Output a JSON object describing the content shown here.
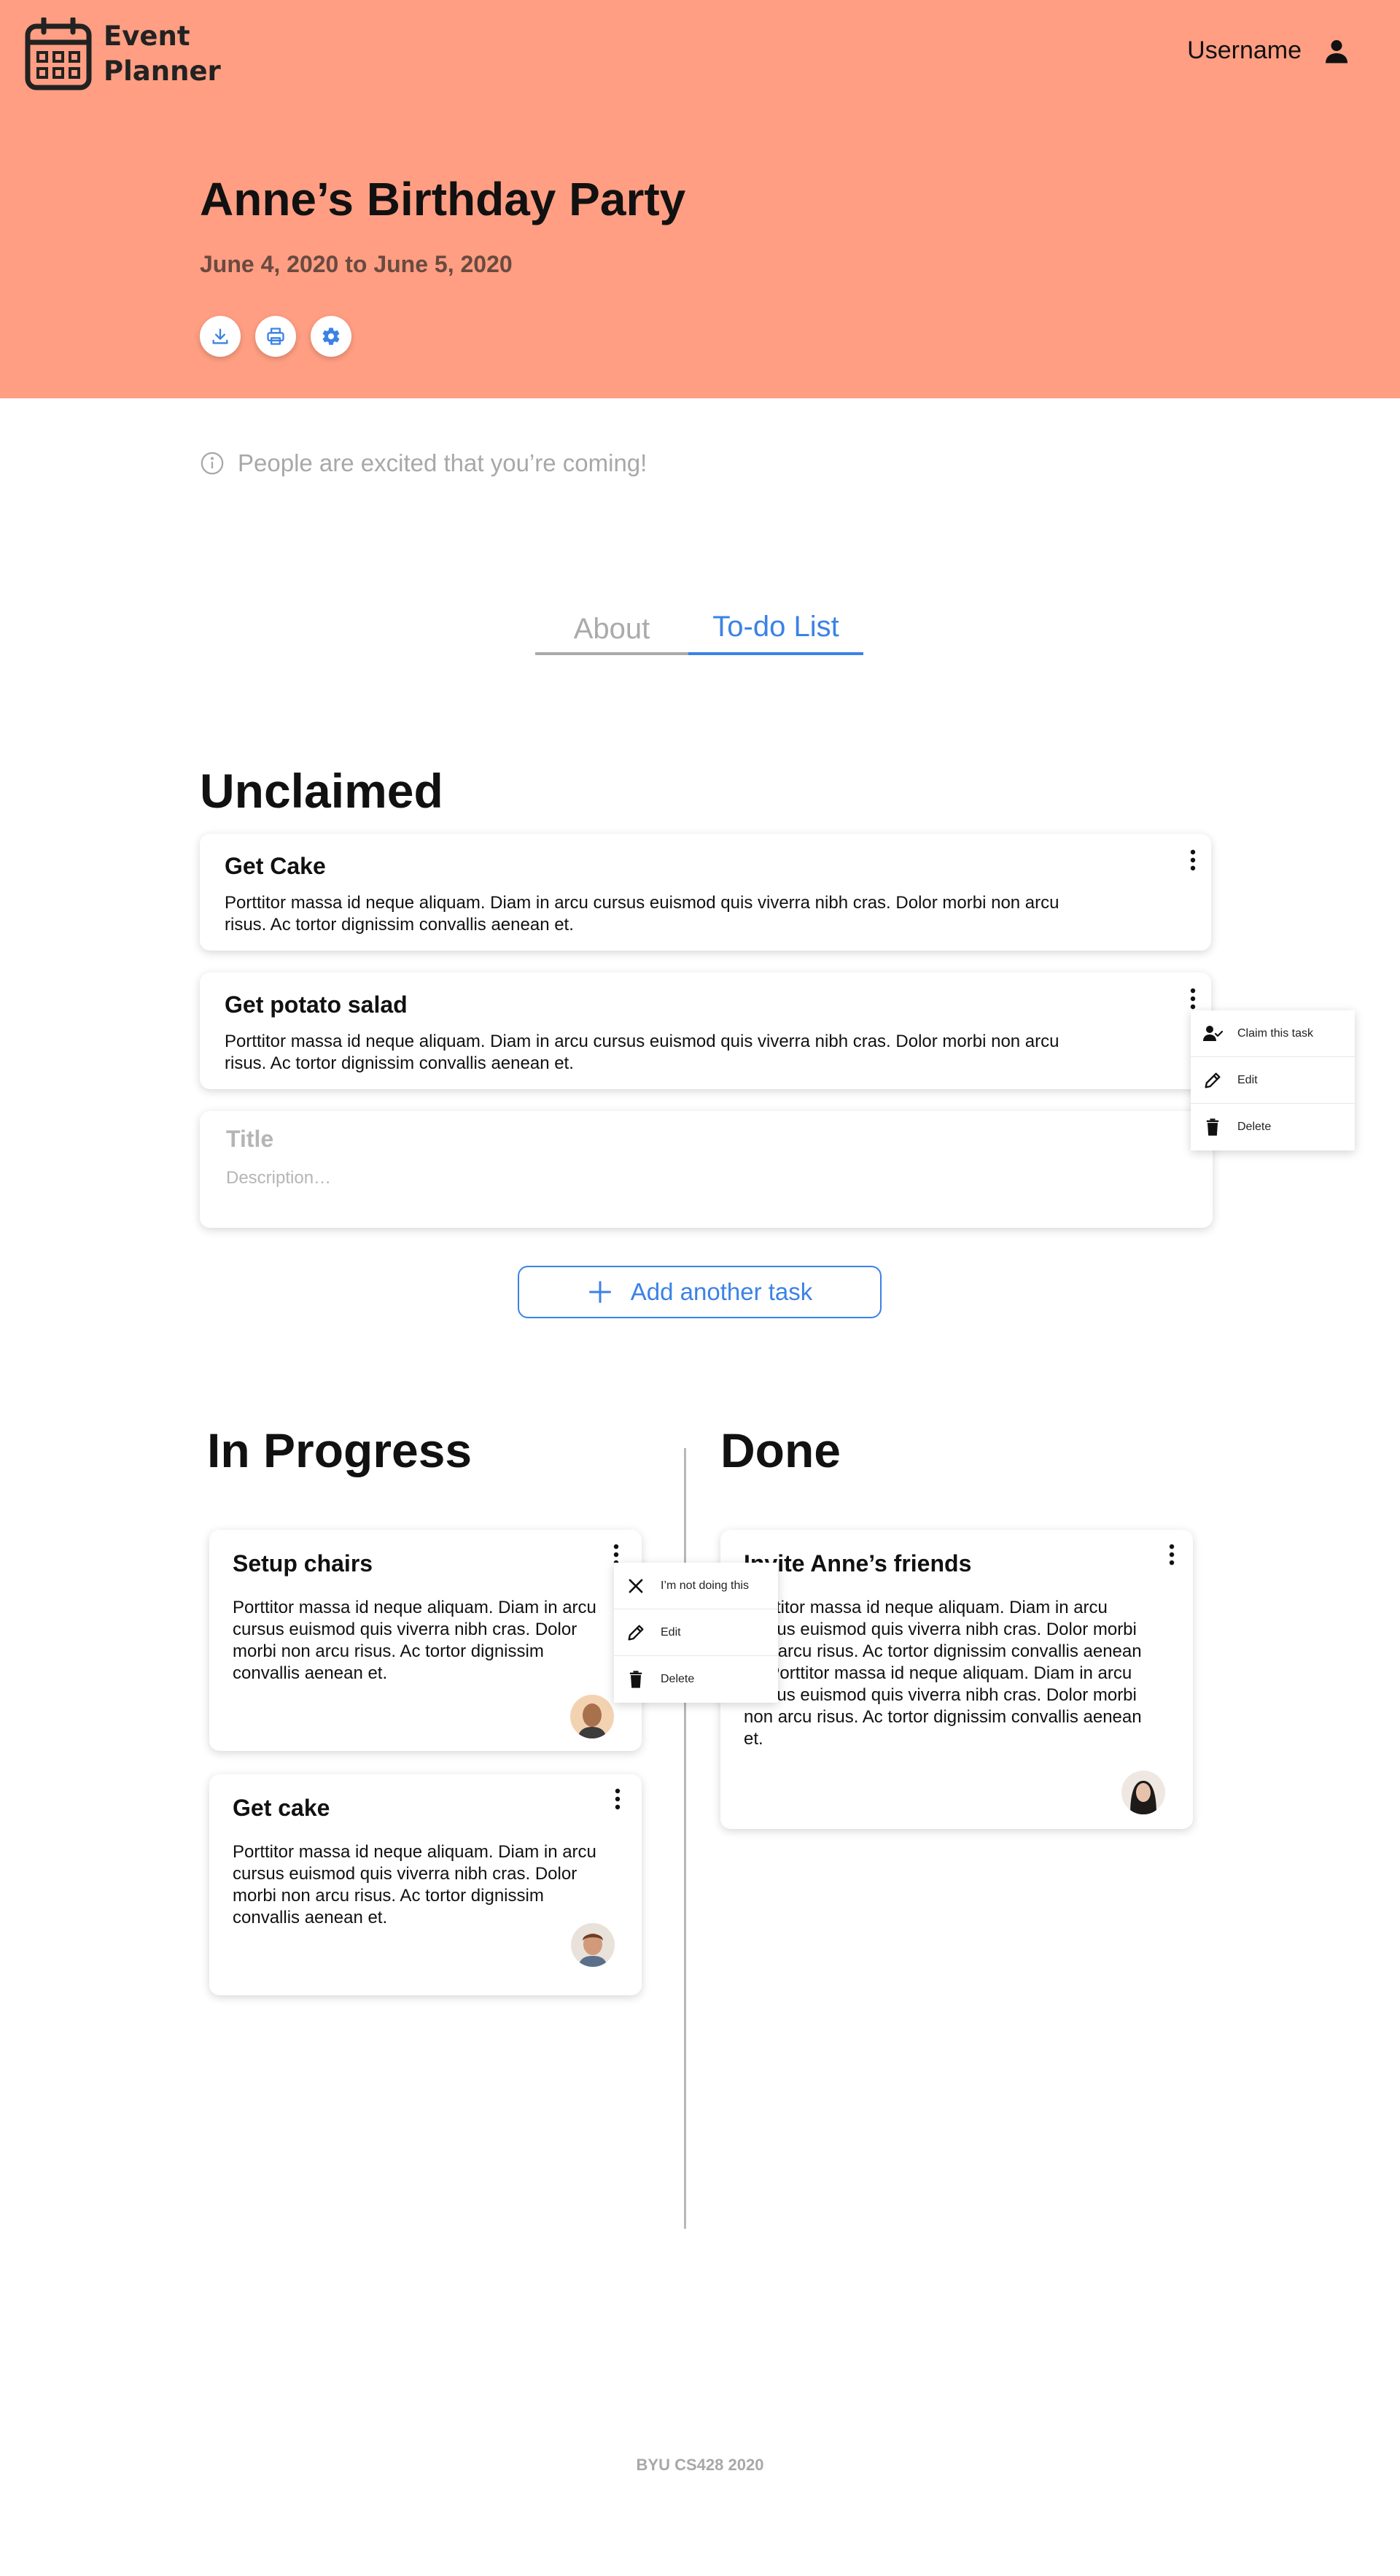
{
  "colors": {
    "header_bg": "#ff9e82",
    "accent": "#3b82e6",
    "muted": "#a8a8a8"
  },
  "app": {
    "name_line1": "Event",
    "name_line2": "Planner",
    "logo_icon": "calendar-icon"
  },
  "user": {
    "name": "Username",
    "icon": "person-icon"
  },
  "event": {
    "title": "Anne’s Birthday Party",
    "dates": "June 4, 2020 to June 5, 2020"
  },
  "actions": [
    {
      "icon": "download-icon"
    },
    {
      "icon": "print-icon"
    },
    {
      "icon": "gear-icon"
    }
  ],
  "info": {
    "icon": "info-icon",
    "text": "People are excited that you’re coming!"
  },
  "tabs": [
    {
      "label": "About",
      "active": false
    },
    {
      "label": "To-do List",
      "active": true
    }
  ],
  "unclaimed": {
    "title": "Unclaimed",
    "tasks": [
      {
        "title": "Get Cake",
        "desc_line1": "Porttitor massa id neque aliquam. Diam in arcu cursus euismod quis viverra nibh cras. Dolor morbi non arcu",
        "desc_line2": "risus. Ac tortor dignissim convallis aenean et."
      },
      {
        "title": "Get potato salad",
        "desc_line1": "Porttitor massa id neque aliquam. Diam in arcu cursus euismod quis viverra nibh cras. Dolor morbi non arcu",
        "desc_line2": "risus. Ac tortor dignissim convallis aenean et."
      }
    ],
    "new_task": {
      "title_placeholder": "Title",
      "desc_placeholder": "Description…"
    },
    "add_button": "Add another task"
  },
  "unclaimed_menu": [
    {
      "label": "Claim this task",
      "icon": "claim-user-check-icon"
    },
    {
      "label": "Edit",
      "icon": "pencil-icon"
    },
    {
      "label": "Delete",
      "icon": "trash-icon"
    }
  ],
  "in_progress": {
    "title": "In Progress",
    "tasks": [
      {
        "title": "Setup chairs",
        "desc_lines": [
          "Porttitor massa id neque aliquam. Diam in arcu",
          "cursus euismod quis viverra nibh cras. Dolor",
          "morbi non arcu risus. Ac tortor dignissim",
          "convallis aenean et."
        ],
        "avatar": "avatar-man-bald"
      },
      {
        "title": "Get cake",
        "desc_lines": [
          "Porttitor massa id neque aliquam. Diam in arcu",
          "cursus euismod quis viverra nibh cras. Dolor",
          "morbi non arcu risus. Ac tortor dignissim",
          "convallis aenean et."
        ],
        "avatar": "avatar-man-brown-hair"
      }
    ]
  },
  "progress_menu": [
    {
      "label": "I’m not doing this",
      "icon": "close-icon"
    },
    {
      "label": "Edit",
      "icon": "pencil-icon"
    },
    {
      "label": "Delete",
      "icon": "trash-icon"
    }
  ],
  "done": {
    "title": "Done",
    "tasks": [
      {
        "title": "Invite Anne’s friends",
        "desc_lines": [
          "Porttitor massa id neque aliquam. Diam in arcu",
          "cursus euismod quis viverra nibh cras. Dolor morbi",
          "non arcu risus. Ac tortor dignissim convallis aenean",
          "et. Porttitor massa id neque aliquam. Diam in arcu",
          "cursus euismod quis viverra nibh cras. Dolor morbi",
          "non arcu risus. Ac tortor dignissim convallis aenean",
          "et."
        ],
        "avatar": "avatar-woman-dark-hair"
      }
    ]
  },
  "footer": "BYU CS428 2020"
}
